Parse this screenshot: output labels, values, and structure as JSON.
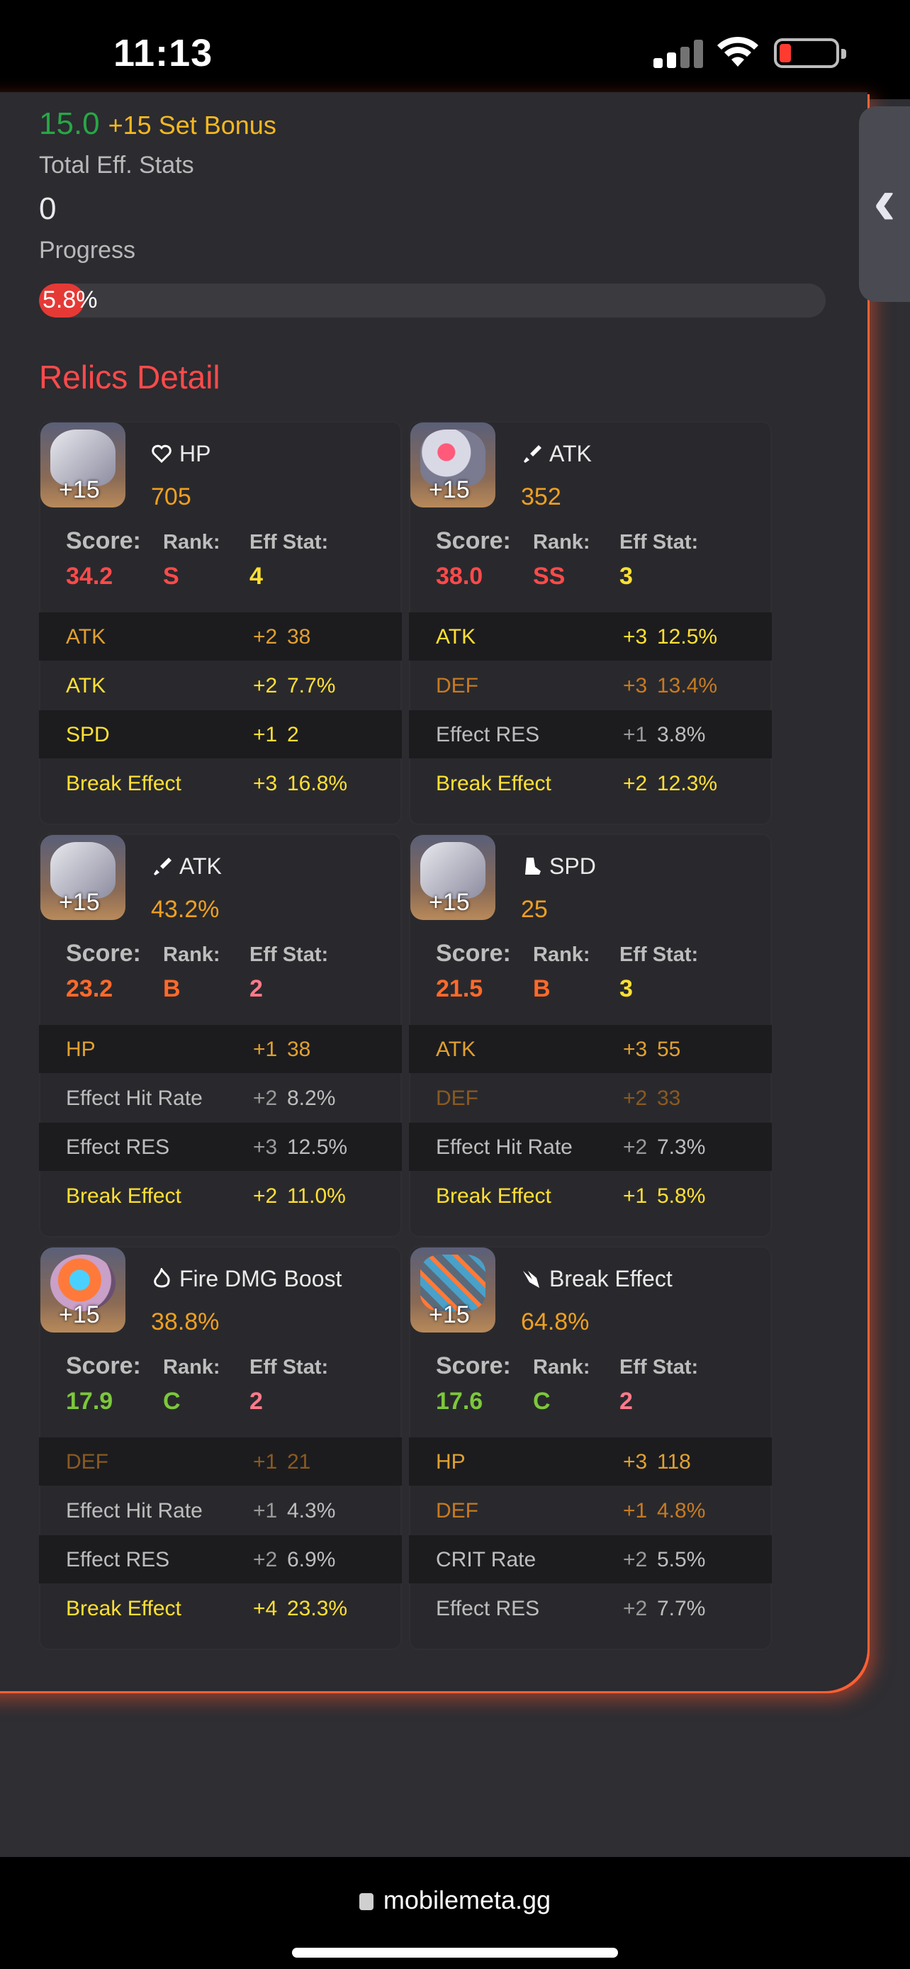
{
  "status": {
    "time": "11:13"
  },
  "summary": {
    "set_value": "15.0",
    "set_bonus": "+15 Set Bonus",
    "total_eff_label": "Total Eff. Stats",
    "total_eff_value": "0",
    "progress_label": "Progress",
    "progress_text": "5.8%",
    "progress_fraction": 0.058
  },
  "section_title": "Relics Detail",
  "labels": {
    "score": "Score:",
    "rank": "Rank:",
    "eff": "Eff Stat:"
  },
  "colors": {
    "accent": "#ff4a4a",
    "gold": "#f5b820",
    "green": "#27a745"
  },
  "cards": [
    {
      "level": "+15",
      "icon": "heart-icon",
      "main": "HP",
      "main_value": "705",
      "score": "34.2",
      "rank": "S",
      "eff": "4",
      "score_color": "#ff4a4a",
      "rank_color": "#ff4a4a",
      "eff_color": "#ffe033",
      "subs": [
        {
          "name": "ATK",
          "roll": "+2",
          "val": "38",
          "color": "#e0a030",
          "roll_color": "#e0a030"
        },
        {
          "name": "ATK",
          "roll": "+2",
          "val": "7.7%",
          "color": "#ffe033",
          "roll_color": "#ffe033"
        },
        {
          "name": "SPD",
          "roll": "+1",
          "val": "2",
          "color": "#ffe033",
          "roll_color": "#ffe033"
        },
        {
          "name": "Break Effect",
          "roll": "+3",
          "val": "16.8%",
          "color": "#ffe033",
          "roll_color": "#ffe033"
        }
      ]
    },
    {
      "level": "+15",
      "icon": "sword-icon",
      "main": "ATK",
      "main_value": "352",
      "score": "38.0",
      "rank": "SS",
      "eff": "3",
      "score_color": "#ff4a4a",
      "rank_color": "#ff4a4a",
      "eff_color": "#ffe033",
      "subs": [
        {
          "name": "ATK",
          "roll": "+3",
          "val": "12.5%",
          "color": "#ffe033",
          "roll_color": "#ffe033"
        },
        {
          "name": "DEF",
          "roll": "+3",
          "val": "13.4%",
          "color": "#c87a20",
          "roll_color": "#c87a20"
        },
        {
          "name": "Effect RES",
          "roll": "+1",
          "val": "3.8%",
          "color": "#bdbdbd",
          "roll_color": "#9a9a9a"
        },
        {
          "name": "Break Effect",
          "roll": "+2",
          "val": "12.3%",
          "color": "#ffe033",
          "roll_color": "#ffe033"
        }
      ]
    },
    {
      "level": "+15",
      "icon": "sword-icon",
      "main": "ATK",
      "main_value": "43.2%",
      "score": "23.2",
      "rank": "B",
      "eff": "2",
      "score_color": "#ff6a2a",
      "rank_color": "#ff6a2a",
      "eff_color": "#ff7a8a",
      "subs": [
        {
          "name": "HP",
          "roll": "+1",
          "val": "38",
          "color": "#e0a030",
          "roll_color": "#e0a030"
        },
        {
          "name": "Effect Hit Rate",
          "roll": "+2",
          "val": "8.2%",
          "color": "#bdbdbd",
          "roll_color": "#9a9a9a"
        },
        {
          "name": "Effect RES",
          "roll": "+3",
          "val": "12.5%",
          "color": "#bdbdbd",
          "roll_color": "#9a9a9a"
        },
        {
          "name": "Break Effect",
          "roll": "+2",
          "val": "11.0%",
          "color": "#ffe033",
          "roll_color": "#ffe033"
        }
      ]
    },
    {
      "level": "+15",
      "icon": "boot-icon",
      "main": "SPD",
      "main_value": "25",
      "score": "21.5",
      "rank": "B",
      "eff": "3",
      "score_color": "#ff6a2a",
      "rank_color": "#ff6a2a",
      "eff_color": "#ffe033",
      "subs": [
        {
          "name": "ATK",
          "roll": "+3",
          "val": "55",
          "color": "#e0a030",
          "roll_color": "#e0a030"
        },
        {
          "name": "DEF",
          "roll": "+2",
          "val": "33",
          "color": "#8a5a20",
          "roll_color": "#8a5a20"
        },
        {
          "name": "Effect Hit Rate",
          "roll": "+2",
          "val": "7.3%",
          "color": "#bdbdbd",
          "roll_color": "#9a9a9a"
        },
        {
          "name": "Break Effect",
          "roll": "+1",
          "val": "5.8%",
          "color": "#ffe033",
          "roll_color": "#ffe033"
        }
      ]
    },
    {
      "level": "+15",
      "icon": "fire-icon",
      "main": "Fire DMG Boost",
      "main_value": "38.8%",
      "score": "17.9",
      "rank": "C",
      "eff": "2",
      "score_color": "#7cc83a",
      "rank_color": "#7cc83a",
      "eff_color": "#ff7a8a",
      "subs": [
        {
          "name": "DEF",
          "roll": "+1",
          "val": "21",
          "color": "#8a5a20",
          "roll_color": "#8a5a20"
        },
        {
          "name": "Effect Hit Rate",
          "roll": "+1",
          "val": "4.3%",
          "color": "#bdbdbd",
          "roll_color": "#9a9a9a"
        },
        {
          "name": "Effect RES",
          "roll": "+2",
          "val": "6.9%",
          "color": "#bdbdbd",
          "roll_color": "#9a9a9a"
        },
        {
          "name": "Break Effect",
          "roll": "+4",
          "val": "23.3%",
          "color": "#ffe033",
          "roll_color": "#ffe033"
        }
      ]
    },
    {
      "level": "+15",
      "icon": "break-effect-icon",
      "main": "Break Effect",
      "main_value": "64.8%",
      "score": "17.6",
      "rank": "C",
      "eff": "2",
      "score_color": "#7cc83a",
      "rank_color": "#7cc83a",
      "eff_color": "#ff7a8a",
      "subs": [
        {
          "name": "HP",
          "roll": "+3",
          "val": "118",
          "color": "#e0a030",
          "roll_color": "#e0a030"
        },
        {
          "name": "DEF",
          "roll": "+1",
          "val": "4.8%",
          "color": "#c87a20",
          "roll_color": "#c87a20"
        },
        {
          "name": "CRIT Rate",
          "roll": "+2",
          "val": "5.5%",
          "color": "#bdbdbd",
          "roll_color": "#9a9a9a"
        },
        {
          "name": "Effect RES",
          "roll": "+2",
          "val": "7.7%",
          "color": "#bdbdbd",
          "roll_color": "#9a9a9a"
        }
      ]
    }
  ],
  "browser": {
    "url": "mobilemeta.gg"
  }
}
